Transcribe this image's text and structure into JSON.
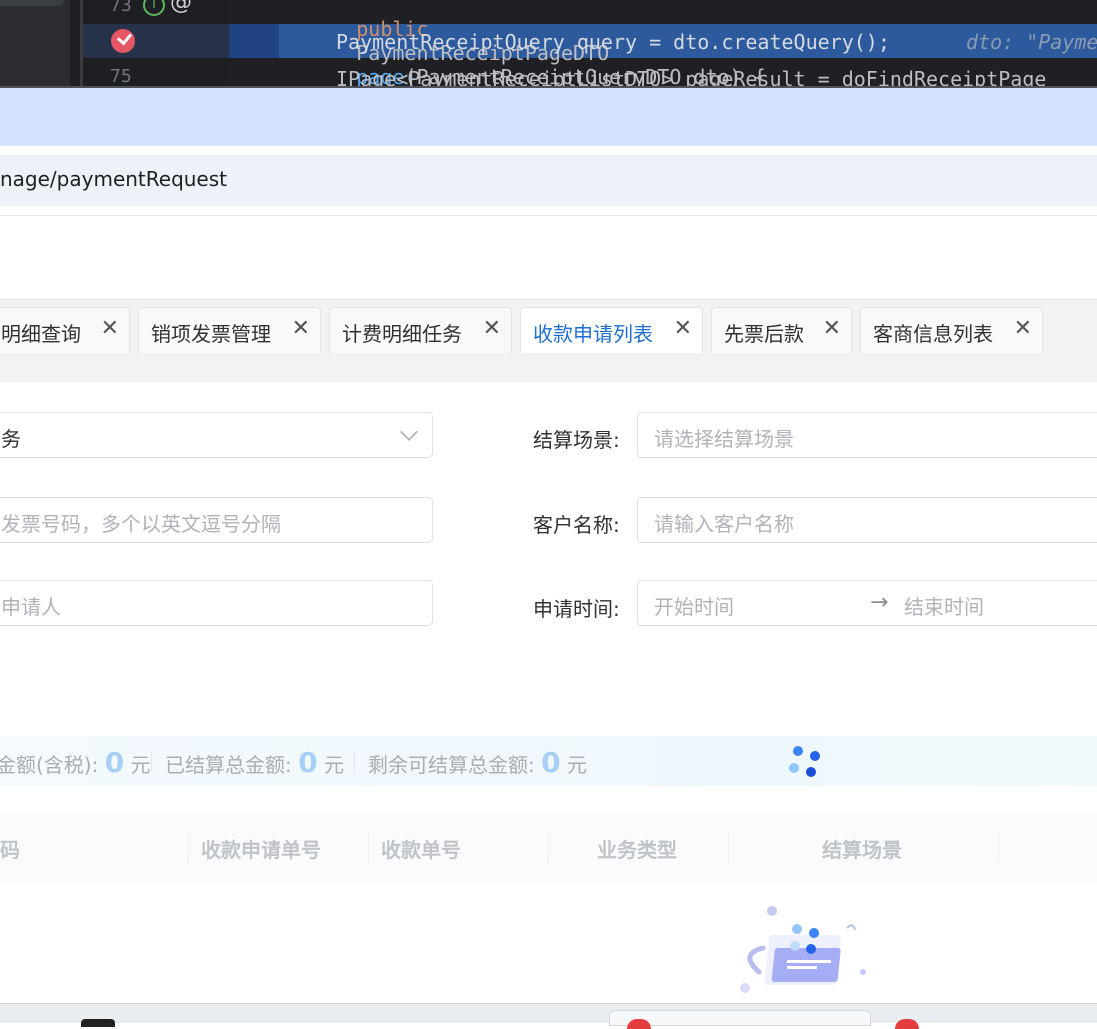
{
  "ide": {
    "line_numbers": [
      "73",
      "",
      "75"
    ],
    "line1": {
      "kw1": "public",
      "type": "PaymentReceiptPageDTO",
      "fn": "page",
      "args": "(PaymentReceiptQueryDTO dto) {"
    },
    "line2": {
      "code": "PaymentReceiptQuery query = dto.createQuery();",
      "hint": "dto: \"Payme"
    },
    "line3": {
      "code": "IPage<PaymentReceiptListDTO> pageResult = doFindReceiptPage"
    }
  },
  "browser": {
    "url": "nage/paymentRequest"
  },
  "tabs": [
    {
      "label": "明细查询",
      "active": false
    },
    {
      "label": "销项发票管理",
      "active": false
    },
    {
      "label": "计费明细任务",
      "active": false
    },
    {
      "label": "收款申请列表",
      "active": true
    },
    {
      "label": "先票后款",
      "active": false
    },
    {
      "label": "客商信息列表",
      "active": false
    }
  ],
  "tab_close": "✕",
  "form": {
    "business_type_value": "务",
    "invoice_placeholder": "发票号码，多个以英文逗号分隔",
    "applicant_placeholder": "申请人",
    "settle_scene_label": "结算场景:",
    "settle_scene_placeholder": "请选择结算场景",
    "customer_label": "客户名称:",
    "customer_placeholder": "请输入客户名称",
    "apply_time_label": "申请时间:",
    "start_placeholder": "开始时间",
    "end_placeholder": "结束时间",
    "range_arrow": "→"
  },
  "summary": {
    "item1_label": "金额(含税):",
    "item1_value": "0",
    "item1_unit": "元",
    "item2_label": "已结算总金额:",
    "item2_value": "0",
    "item2_unit": "元",
    "item3_label": "剩余可结算总金额:",
    "item3_value": "0",
    "item3_unit": "元"
  },
  "table": {
    "headers": [
      "码",
      "收款申请单号",
      "收款单号",
      "业务类型",
      "结算场景"
    ]
  },
  "colors": {
    "active_tab": "#1f6fd1",
    "summary_number": "#a8cff5",
    "loader": "#3b82f6",
    "breakpoint": "#e55765"
  },
  "icons": [
    "breakpoint-icon",
    "implementation-icon",
    "annotation-icon",
    "close-icon",
    "chevron-down-icon",
    "loading-icon",
    "empty-data-illustration"
  ]
}
